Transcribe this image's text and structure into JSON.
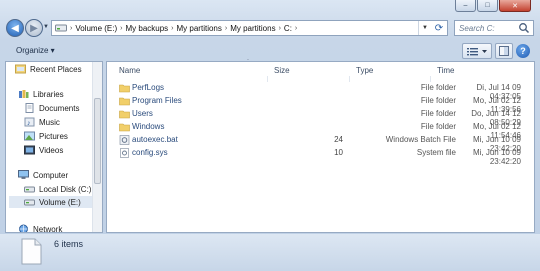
{
  "window": {
    "buttons": {
      "minimize": "–",
      "maximize": "□",
      "close": "✕"
    }
  },
  "address": {
    "crumbs": [
      "Volume (E:)",
      "My backups",
      "My partitions",
      "My partitions",
      "C:"
    ],
    "search_placeholder": "Search C:"
  },
  "toolbar": {
    "organize": "Organize ▾"
  },
  "nav": {
    "items": [
      {
        "label": "Recent Places",
        "icon": "recent-places-icon"
      },
      {
        "label": "Libraries",
        "icon": "libraries-icon"
      },
      {
        "label": "Documents",
        "icon": "documents-icon"
      },
      {
        "label": "Music",
        "icon": "music-icon"
      },
      {
        "label": "Pictures",
        "icon": "pictures-icon"
      },
      {
        "label": "Videos",
        "icon": "videos-icon"
      },
      {
        "label": "Computer",
        "icon": "computer-icon"
      },
      {
        "label": "Local Disk (C:)",
        "icon": "drive-icon"
      },
      {
        "label": "Volume (E:)",
        "icon": "drive-icon"
      },
      {
        "label": "Network",
        "icon": "network-icon"
      }
    ]
  },
  "list": {
    "columns": {
      "name": "Name",
      "size": "Size",
      "type": "Type",
      "time": "Time"
    },
    "rows": [
      {
        "name": "PerfLogs",
        "size": "",
        "type": "File folder",
        "time": "Di, Jul 14 09 04:37:05",
        "icon": "folder-icon"
      },
      {
        "name": "Program Files",
        "size": "",
        "type": "File folder",
        "time": "Mo, Jul 02 12 11:39:56",
        "icon": "folder-icon"
      },
      {
        "name": "Users",
        "size": "",
        "type": "File folder",
        "time": "Do, Jun 14 12 08:50:29",
        "icon": "folder-icon"
      },
      {
        "name": "Windows",
        "size": "",
        "type": "File folder",
        "time": "Mo, Jul 02 12 11:54:46",
        "icon": "folder-icon"
      },
      {
        "name": "autoexec.bat",
        "size": "24",
        "type": "Windows Batch File",
        "time": "Mi, Jun 10 09 23:42:20",
        "icon": "batch-file-icon"
      },
      {
        "name": "config.sys",
        "size": "10",
        "type": "System file",
        "time": "Mi, Jun 10 09 23:42:20",
        "icon": "system-file-icon"
      }
    ]
  },
  "status": {
    "count": "6 items"
  },
  "colors": {
    "accent": "#2a4b7c",
    "chrome": "#c7d6e8"
  }
}
